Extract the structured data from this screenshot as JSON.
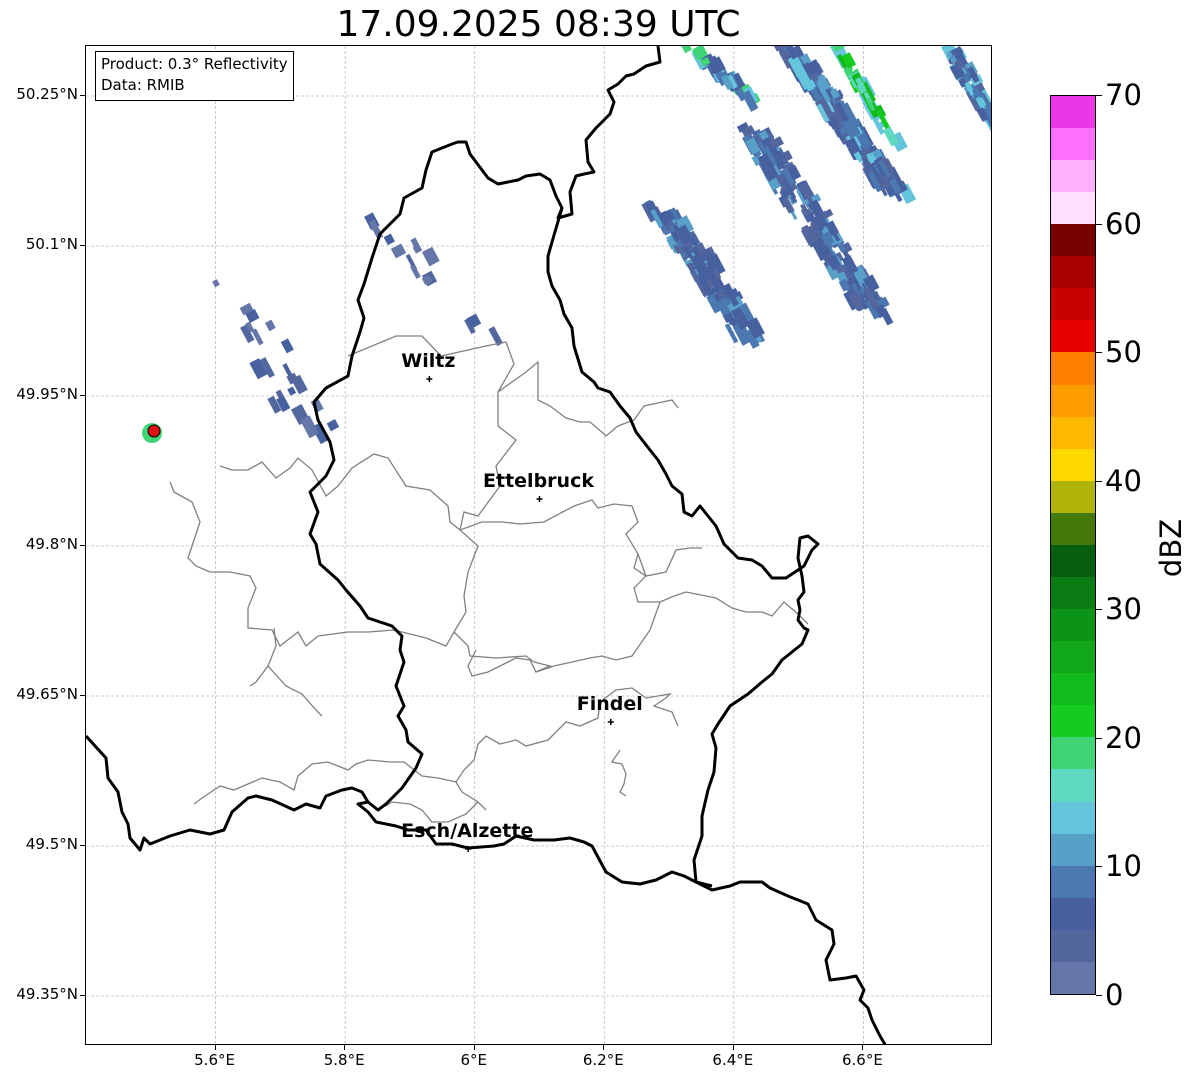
{
  "title": "17.09.2025 08:39 UTC",
  "info": {
    "product": "Product: 0.3° Reflectivity",
    "data_source": "Data: RMIB"
  },
  "lat_labels": [
    "50.25°N",
    "50.1°N",
    "49.95°N",
    "49.8°N",
    "49.65°N",
    "49.5°N",
    "49.35°N"
  ],
  "lon_labels": [
    "5.6°E",
    "5.8°E",
    "6°E",
    "6.2°E",
    "6.4°E",
    "6.6°E"
  ],
  "cities": [
    {
      "name": "Wiltz",
      "lon": 5.93,
      "lat": 49.967
    },
    {
      "name": "Ettelbruck",
      "lon": 6.1,
      "lat": 49.847
    },
    {
      "name": "Findel",
      "lon": 6.21,
      "lat": 49.624
    },
    {
      "name": "Esch/Alzette",
      "lon": 5.99,
      "lat": 49.497
    }
  ],
  "radar_site": {
    "lon": 5.505,
    "lat": 49.915,
    "color": "#dd1111"
  },
  "colorbar": {
    "unit": "dBZ",
    "tick_labels": [
      "0",
      "10",
      "20",
      "30",
      "40",
      "50",
      "60",
      "70"
    ],
    "min": 0,
    "max": 70,
    "step": 2.5,
    "colors": [
      "#6577a8",
      "#53679e",
      "#4660a0",
      "#4b78b0",
      "#58a0c8",
      "#65c5dc",
      "#5fd8c0",
      "#3fd474",
      "#14cc20",
      "#12bb1c",
      "#10a81a",
      "#0c9418",
      "#0b7c14",
      "#075e0e",
      "#447a0a",
      "#b0b40a",
      "#ffd800",
      "#ffb800",
      "#ff9c00",
      "#ff8000",
      "#e80000",
      "#c80000",
      "#a80000",
      "#7a0000",
      "#ffe0ff",
      "#ffb0ff",
      "#ff70ff",
      "#e838e8"
    ]
  },
  "map_extent": {
    "lon_min": 5.4,
    "lon_max": 6.8,
    "lat_min": 49.3,
    "lat_max": 50.3
  },
  "colors": {
    "border": "#000000",
    "canton_lines": "#808080",
    "grid": "#bbbbbb"
  }
}
